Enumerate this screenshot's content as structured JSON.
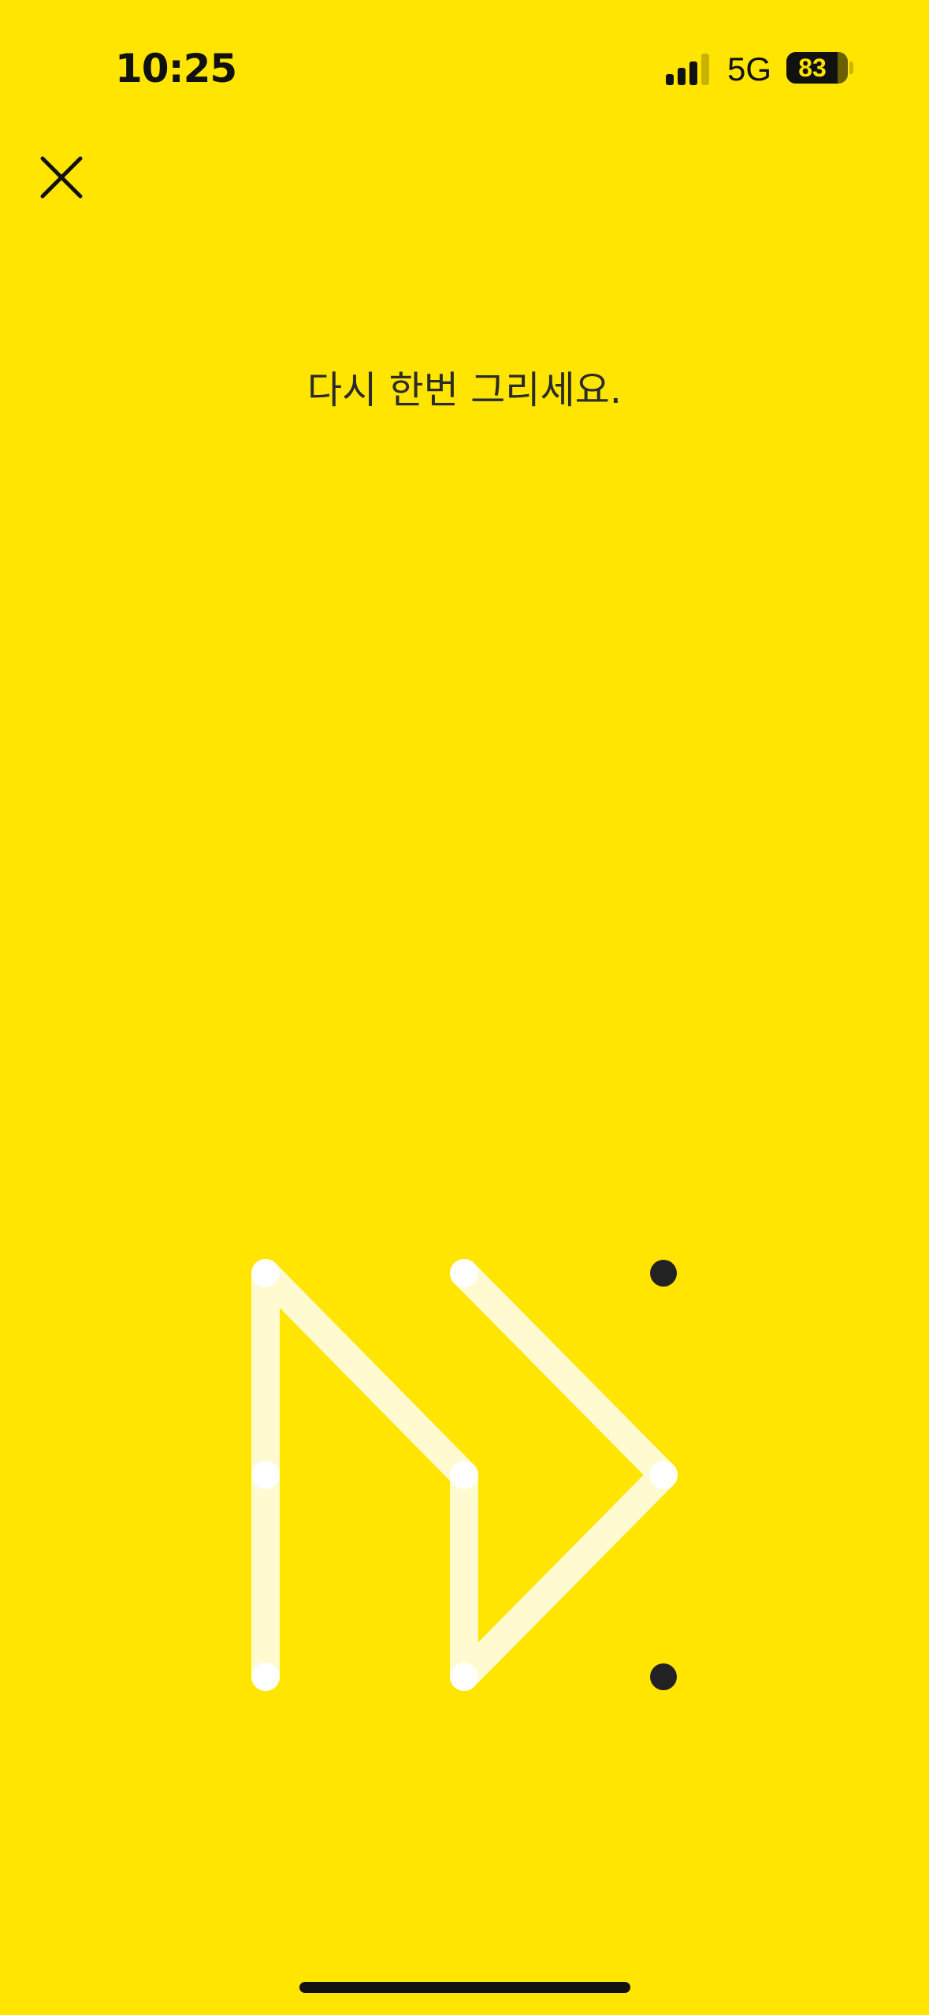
{
  "status_bar": {
    "time": "10:25",
    "signal_bars_active": 3,
    "signal_bars_total": 4,
    "network": "5G",
    "battery_level": 83,
    "battery_label": "83"
  },
  "header": {
    "close_icon": "close-icon"
  },
  "prompt": "다시 한번 그리세요.",
  "pattern_lock": {
    "grid_rows": 3,
    "grid_cols": 3,
    "dots": [
      {
        "id": 1,
        "row": 1,
        "col": 1,
        "selected": true
      },
      {
        "id": 2,
        "row": 1,
        "col": 2,
        "selected": true
      },
      {
        "id": 3,
        "row": 1,
        "col": 3,
        "selected": false
      },
      {
        "id": 4,
        "row": 2,
        "col": 1,
        "selected": true
      },
      {
        "id": 5,
        "row": 2,
        "col": 2,
        "selected": true
      },
      {
        "id": 6,
        "row": 2,
        "col": 3,
        "selected": true
      },
      {
        "id": 7,
        "row": 3,
        "col": 1,
        "selected": true
      },
      {
        "id": 8,
        "row": 3,
        "col": 2,
        "selected": true
      },
      {
        "id": 9,
        "row": 3,
        "col": 3,
        "selected": false
      }
    ],
    "drawn_path": [
      7,
      4,
      1,
      5,
      8,
      6,
      2
    ]
  },
  "colors": {
    "background": "#FFE500",
    "text": "#111111",
    "prompt_text": "#2A2A2A",
    "dot_unselected": "#222222",
    "dot_selected": "#FFFFFF",
    "path_line": "#FFFAD0",
    "signal_active": "#111111",
    "signal_inactive": "#C8B400",
    "battery_fill": "#111111",
    "battery_text": "#FFE500",
    "home_indicator": "#111111"
  }
}
